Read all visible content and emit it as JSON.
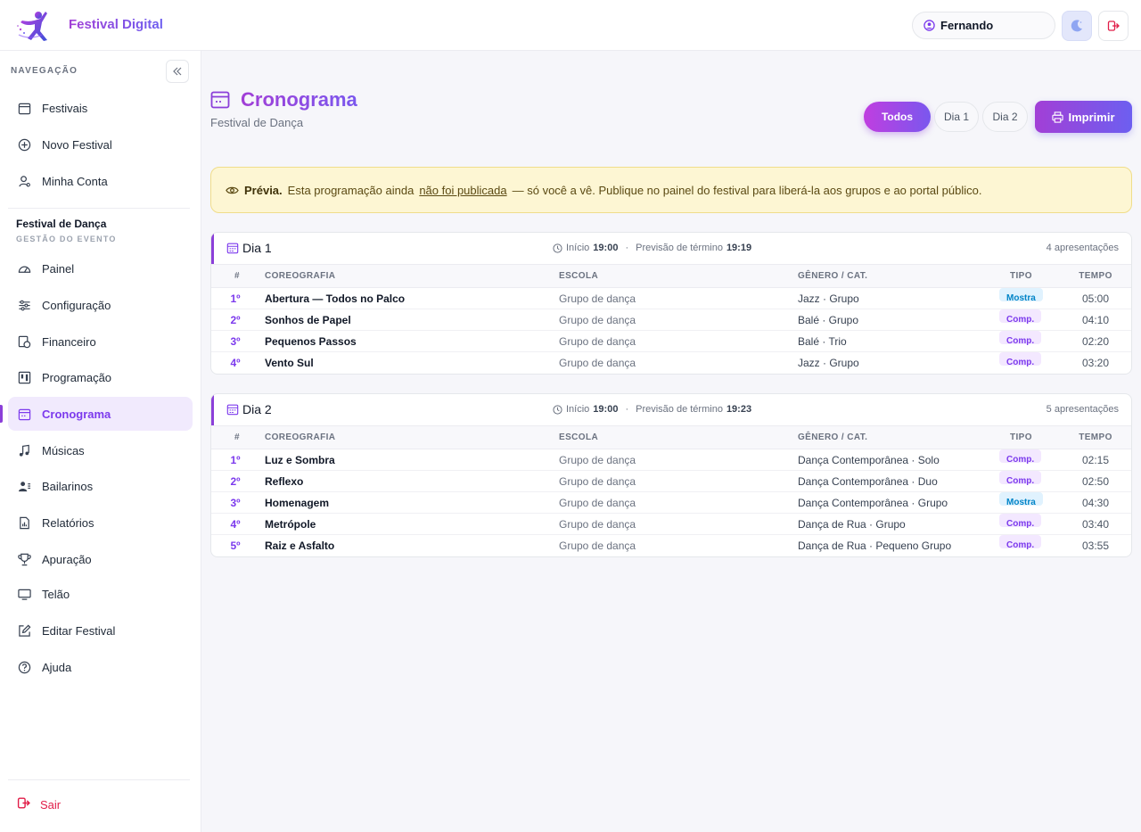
{
  "app": {
    "name": "Festival Digital",
    "user": "Fernando"
  },
  "sidebar": {
    "nav_label": "NAVEGAÇÃO",
    "main_items": [
      {
        "label": "Festivais",
        "icon": "calendar-icon"
      },
      {
        "label": "Novo Festival",
        "icon": "plus-circle-icon"
      },
      {
        "label": "Minha Conta",
        "icon": "user-icon"
      }
    ],
    "event": {
      "title": "Festival de Dança",
      "subtitle": "GESTÃO DO EVENTO"
    },
    "event_items": [
      {
        "label": "Painel",
        "icon": "gauge-icon"
      },
      {
        "label": "Configuração",
        "icon": "sliders-icon"
      },
      {
        "label": "Financeiro",
        "icon": "money-icon"
      },
      {
        "label": "Programação",
        "icon": "columns-icon"
      },
      {
        "label": "Cronograma",
        "icon": "calendar-icon",
        "active": true
      },
      {
        "label": "Músicas",
        "icon": "music-icon"
      },
      {
        "label": "Bailarinos",
        "icon": "people-icon"
      },
      {
        "label": "Relatórios",
        "icon": "report-icon"
      },
      {
        "label": "Apuração",
        "icon": "trophy-icon"
      },
      {
        "label": "Telão",
        "icon": "monitor-icon"
      },
      {
        "label": "Editar Festival",
        "icon": "edit-icon"
      },
      {
        "label": "Ajuda",
        "icon": "help-icon"
      }
    ],
    "logout": "Sair"
  },
  "page": {
    "title": "Cronograma",
    "subtitle": "Festival de Dança",
    "filters": {
      "all": "Todos",
      "day1": "Dia 1",
      "day2": "Dia 2"
    },
    "print": "Imprimir"
  },
  "notice": {
    "bold": "Prévia.",
    "text1": "Esta programação ainda",
    "link": "não foi publicada",
    "text2": "— só você a vê. Publique no painel do festival para liberá-la aos grupos e ao portal público."
  },
  "columns": {
    "num": "#",
    "coreo": "COREOGRAFIA",
    "escola": "ESCOLA",
    "genero": "GÊNERO / CAT.",
    "tipo": "TIPO",
    "tempo": "TEMPO"
  },
  "days": [
    {
      "name": "Dia 1",
      "start_label": "Início",
      "start": "19:00",
      "end_label": "Previsão de término",
      "end": "19:19",
      "count": "4 apresentações",
      "rows": [
        {
          "num": "1º",
          "coreo": "Abertura — Todos no Palco",
          "escola": "Grupo de dança",
          "genero": "Jazz · Grupo",
          "tipo": "Mostra",
          "tempo": "05:00"
        },
        {
          "num": "2º",
          "coreo": "Sonhos de Papel",
          "escola": "Grupo de dança",
          "genero": "Balé · Grupo",
          "tipo": "Comp.",
          "tempo": "04:10"
        },
        {
          "num": "3º",
          "coreo": "Pequenos Passos",
          "escola": "Grupo de dança",
          "genero": "Balé · Trio",
          "tipo": "Comp.",
          "tempo": "02:20"
        },
        {
          "num": "4º",
          "coreo": "Vento Sul",
          "escola": "Grupo de dança",
          "genero": "Jazz · Grupo",
          "tipo": "Comp.",
          "tempo": "03:20"
        }
      ]
    },
    {
      "name": "Dia 2",
      "start_label": "Início",
      "start": "19:00",
      "end_label": "Previsão de término",
      "end": "19:23",
      "count": "5 apresentações",
      "rows": [
        {
          "num": "1º",
          "coreo": "Luz e Sombra",
          "escola": "Grupo de dança",
          "genero": "Dança Contemporânea · Solo",
          "tipo": "Comp.",
          "tempo": "02:15"
        },
        {
          "num": "2º",
          "coreo": "Reflexo",
          "escola": "Grupo de dança",
          "genero": "Dança Contemporânea · Duo",
          "tipo": "Comp.",
          "tempo": "02:50"
        },
        {
          "num": "3º",
          "coreo": "Homenagem",
          "escola": "Grupo de dança",
          "genero": "Dança Contemporânea · Grupo",
          "tipo": "Mostra",
          "tempo": "04:30"
        },
        {
          "num": "4º",
          "coreo": "Metrópole",
          "escola": "Grupo de dança",
          "genero": "Dança de Rua · Grupo",
          "tipo": "Comp.",
          "tempo": "03:40"
        },
        {
          "num": "5º",
          "coreo": "Raiz e Asfalto",
          "escola": "Grupo de dança",
          "genero": "Dança de Rua · Pequeno Grupo",
          "tipo": "Comp.",
          "tempo": "03:55"
        }
      ]
    }
  ]
}
